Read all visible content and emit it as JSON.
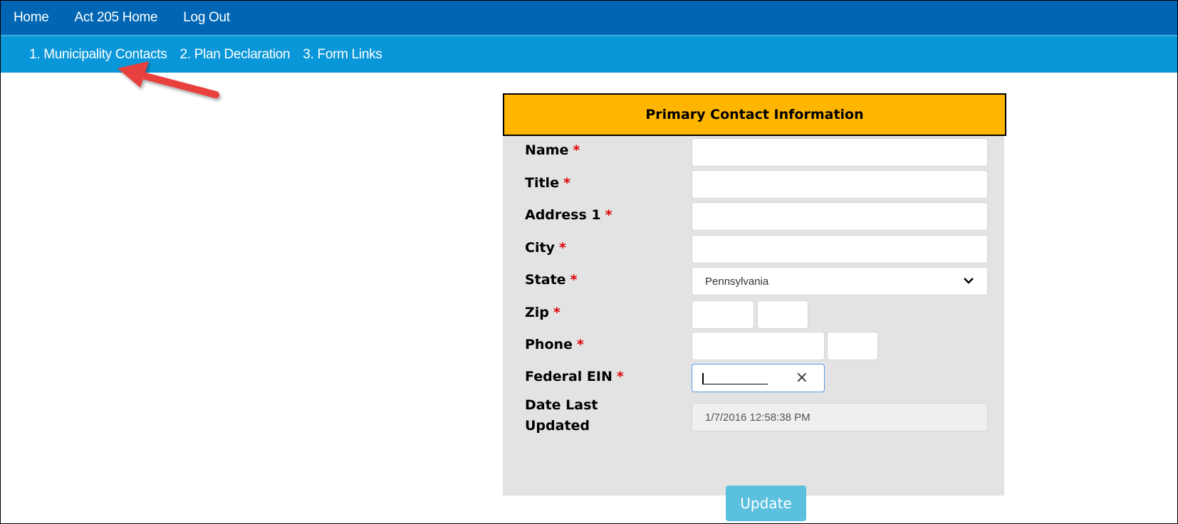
{
  "top_nav": {
    "items": [
      "Home",
      "Act 205 Home",
      "Log Out"
    ]
  },
  "sub_nav": {
    "items": [
      "1. Municipality Contacts",
      "2. Plan Declaration",
      "3. Form Links"
    ]
  },
  "annotation": {
    "arrow_color": "#e8413c",
    "points_to": "1. Municipality Contacts"
  },
  "colors": {
    "top_nav_bg": "#0066b3",
    "sub_nav_bg": "#0a97d9",
    "header_bg": "#ffb600",
    "panel_bg": "#e3e3e3",
    "required": "#e00000",
    "button_bg": "#5bc0de"
  },
  "form": {
    "title": "Primary Contact Information",
    "required_mark": "*",
    "fields": {
      "name": {
        "label": "Name",
        "value": ""
      },
      "title": {
        "label": "Title",
        "value": ""
      },
      "address1": {
        "label": "Address 1",
        "value": ""
      },
      "city": {
        "label": "City",
        "value": ""
      },
      "state": {
        "label": "State",
        "value": "Pennsylvania"
      },
      "zip": {
        "label": "Zip",
        "value": "",
        "ext_value": ""
      },
      "phone": {
        "label": "Phone",
        "value": "",
        "ext_value": ""
      },
      "federal_ein": {
        "label": "Federal EIN",
        "value": "",
        "clear_icon": "×"
      },
      "date_last_updated": {
        "label_line1": "Date Last",
        "label_line2": "Updated",
        "value": "1/7/2016 12:58:38 PM"
      }
    },
    "update_button": "Update"
  }
}
